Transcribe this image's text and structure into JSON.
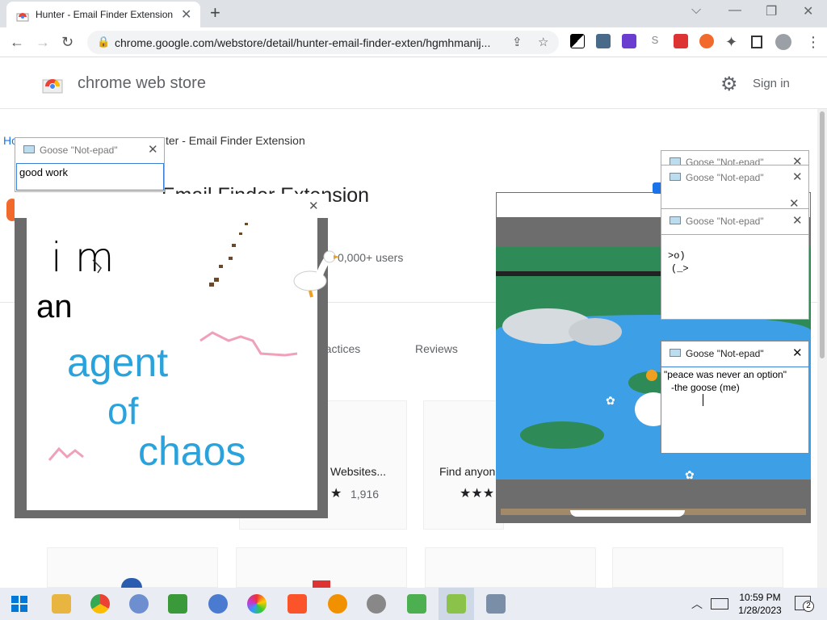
{
  "browser": {
    "tab_title": "Hunter - Email Finder Extension",
    "tab_close": "✕",
    "new_tab": "+",
    "url": "chrome.google.com/webstore/detail/hunter-email-finder-exten/hgmhmanij...",
    "window_controls": [
      "⌵",
      "—",
      "❐",
      "✕"
    ]
  },
  "store": {
    "name": "chrome web store",
    "sign_in": "Sign in",
    "breadcrumb_home": "Ho",
    "breadcrumb_item": "ter - Email Finder Extension",
    "title_fragment": "Email Finder Extension",
    "users": "0,000+ users",
    "tabs": [
      "ractices",
      "Reviews"
    ],
    "cards": [
      {
        "label": "Websites...",
        "rating_count": "1,916"
      },
      {
        "label": "Find anyon"
      }
    ]
  },
  "notepads": {
    "title": "Goose \"Not-epad\"",
    "close": "✕",
    "good_work": "good work",
    "goose_ascii_1": ">o)",
    "goose_ascii_2": "(_>",
    "quote_line1": "\"peace was never an option\"",
    "quote_line2": "-the goose (me)"
  },
  "drawing": {
    "line1": "i  m",
    "line2": "an",
    "line3": "agent",
    "line4": "of",
    "line5": "chaos"
  },
  "taskbar": {
    "time": "10:59 PM",
    "date": "1/28/2023",
    "notifications": "2"
  },
  "colors": {
    "accent_blue": "#1a73e8",
    "drawing_blue": "#2aa3dc",
    "drawing_pink": "#f0a0b8",
    "pond_water": "#3da0e6",
    "pond_grass": "#2e8b57"
  }
}
